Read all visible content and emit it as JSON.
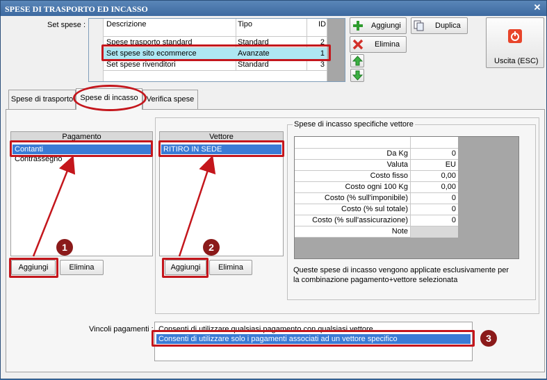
{
  "window": {
    "title": "SPESE DI TRASPORTO ED INCASSO",
    "close_glyph": "✕"
  },
  "setspese": {
    "label": "Set spese :",
    "columns": [
      "Descrizione",
      "Tipo",
      "ID"
    ],
    "rows": [
      {
        "descrizione": "Spese trasporto standard",
        "tipo": "Standard",
        "id": "2"
      },
      {
        "descrizione": "Set spese sito ecommerce",
        "tipo": "Avanzate",
        "id": "1"
      },
      {
        "descrizione": "Set spese rivenditori",
        "tipo": "Standard",
        "id": "3"
      }
    ],
    "selected_index": 1
  },
  "toolbar": {
    "aggiungi": "Aggiungi",
    "duplica": "Duplica",
    "elimina": "Elimina",
    "uscita": "Uscita (ESC)"
  },
  "tabs": [
    {
      "label": "Spese di trasporto"
    },
    {
      "label": "Spese di incasso",
      "active": true
    },
    {
      "label": "Verifica spese"
    }
  ],
  "pagamento": {
    "header": "Pagamento",
    "items": [
      "Contanti",
      "Contrassegno"
    ],
    "selected_index": 0,
    "add_label": "Aggiungi",
    "delete_label": "Elimina"
  },
  "vettore": {
    "header": "Vettore",
    "items": [
      "RITIRO IN SEDE"
    ],
    "selected_index": 0,
    "add_label": "Aggiungi",
    "delete_label": "Elimina"
  },
  "specifiche": {
    "title": "Spese di incasso specifiche vettore",
    "rows": [
      {
        "key": "Da Kg",
        "value": "0"
      },
      {
        "key": "Valuta",
        "value": "EU"
      },
      {
        "key": "Costo fisso",
        "value": "0,00"
      },
      {
        "key": "Costo ogni 100 Kg",
        "value": "0,00"
      },
      {
        "key": "Costo (% sull'imponibile)",
        "value": "0"
      },
      {
        "key": "Costo (% sul totale)",
        "value": "0"
      },
      {
        "key": "Costo (% sull'assicurazione)",
        "value": "0"
      },
      {
        "key": "Note",
        "value": ""
      }
    ],
    "note_line1": "Queste spese di incasso vengono applicate esclusivamente per",
    "note_line2": "la combinazione pagamento+vettore selezionata"
  },
  "vincoli": {
    "label": "Vincoli pagamenti :",
    "options": [
      "Consenti di utilizzare qualsiasi pagamento con qualsiasi vettore",
      "Consenti di utilizzare solo i pagamenti associati ad un vettore specifico"
    ],
    "selected_index": 1
  },
  "badges": [
    "1",
    "2",
    "3"
  ],
  "colors": {
    "highlight": "#c4161c",
    "selection": "#3a7bd5",
    "selected_row": "#aee7f3",
    "badge": "#8b1a1a"
  }
}
